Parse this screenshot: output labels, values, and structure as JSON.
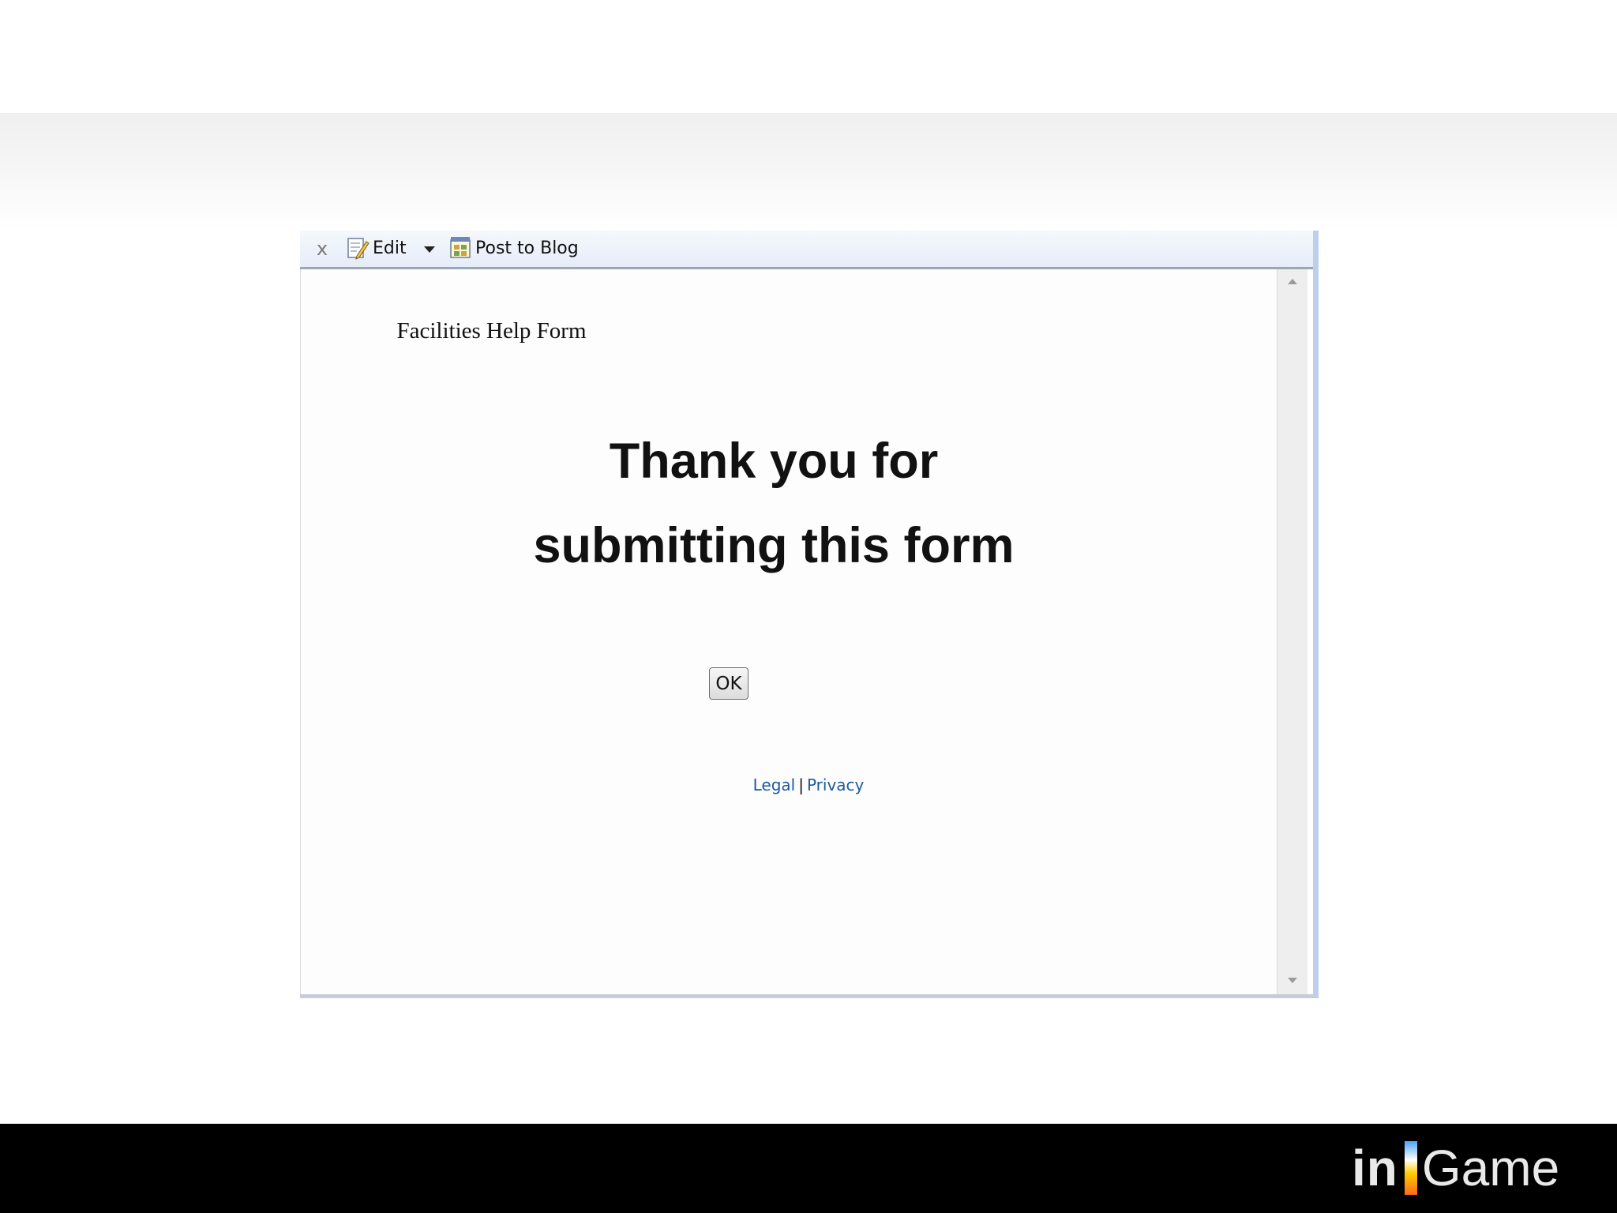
{
  "toolbar": {
    "close_glyph": "x",
    "edit_label": "Edit",
    "post_label": "Post to Blog"
  },
  "content": {
    "form_title": "Facilities Help Form",
    "thanks_line1": "Thank you for",
    "thanks_line2": "submitting this form",
    "ok_label": "OK",
    "legal_label": "Legal",
    "separator": "|",
    "privacy_label": "Privacy"
  },
  "logo": {
    "text_in": "in",
    "text_game": "Game"
  },
  "colors": {
    "link": "#1a5a9e",
    "toolbar_bg": "#e6edf8",
    "footer_bg": "#000000"
  },
  "icons": {
    "close": "close-icon",
    "edit": "edit-pencil-icon",
    "dropdown": "dropdown-arrow-icon",
    "post": "blog-post-icon",
    "scroll_up": "scroll-up-arrow-icon",
    "scroll_down": "scroll-down-arrow-icon"
  }
}
